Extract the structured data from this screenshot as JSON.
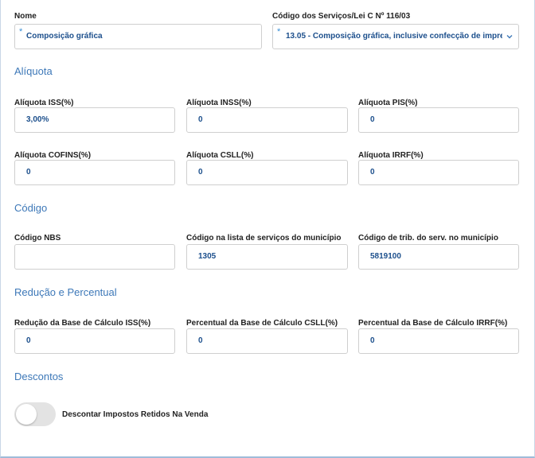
{
  "nome": {
    "label": "Nome",
    "value": "Composição gráfica"
  },
  "codigo_servicos": {
    "label": "Código dos Serviços/Lei C Nº 116/03",
    "value": "13.05 - Composição gráfica, inclusive confecção de impre"
  },
  "sections": {
    "aliquota": "Alíquota",
    "codigo": "Código",
    "reducao": "Redução e Percentual",
    "descontos": "Descontos"
  },
  "aliquota": {
    "iss": {
      "label": "Alíquota ISS(%)",
      "value": "3,00%"
    },
    "inss": {
      "label": "Alíquota INSS(%)",
      "value": "0"
    },
    "pis": {
      "label": "Alíquota PIS(%)",
      "value": "0"
    },
    "cofins": {
      "label": "Alíquota COFINS(%)",
      "value": "0"
    },
    "csll": {
      "label": "Alíquota CSLL(%)",
      "value": "0"
    },
    "irrf": {
      "label": "Alíquota IRRF(%)",
      "value": "0"
    }
  },
  "codigo": {
    "nbs": {
      "label": "Código NBS",
      "value": ""
    },
    "lista": {
      "label": "Código na lista de serviços do município",
      "value": "1305"
    },
    "trib": {
      "label": "Código de trib. do serv. no município",
      "value": "5819100"
    }
  },
  "reducao": {
    "iss": {
      "label": "Redução da Base de Cálculo ISS(%)",
      "value": "0"
    },
    "csll": {
      "label": "Percentual da Base de Cálculo CSLL(%)",
      "value": "0"
    },
    "irrf": {
      "label": "Percentual da Base de Cálculo IRRF(%)",
      "value": "0"
    }
  },
  "descontos": {
    "toggle_label": "Descontar Impostos Retidos Na Venda",
    "toggle_on": false
  },
  "colors": {
    "accent": "#3d78b8",
    "value_text": "#1c4f8c",
    "required_marker": "#3a8fd6"
  },
  "icons": {
    "dropdown": "chevron-down-icon"
  }
}
